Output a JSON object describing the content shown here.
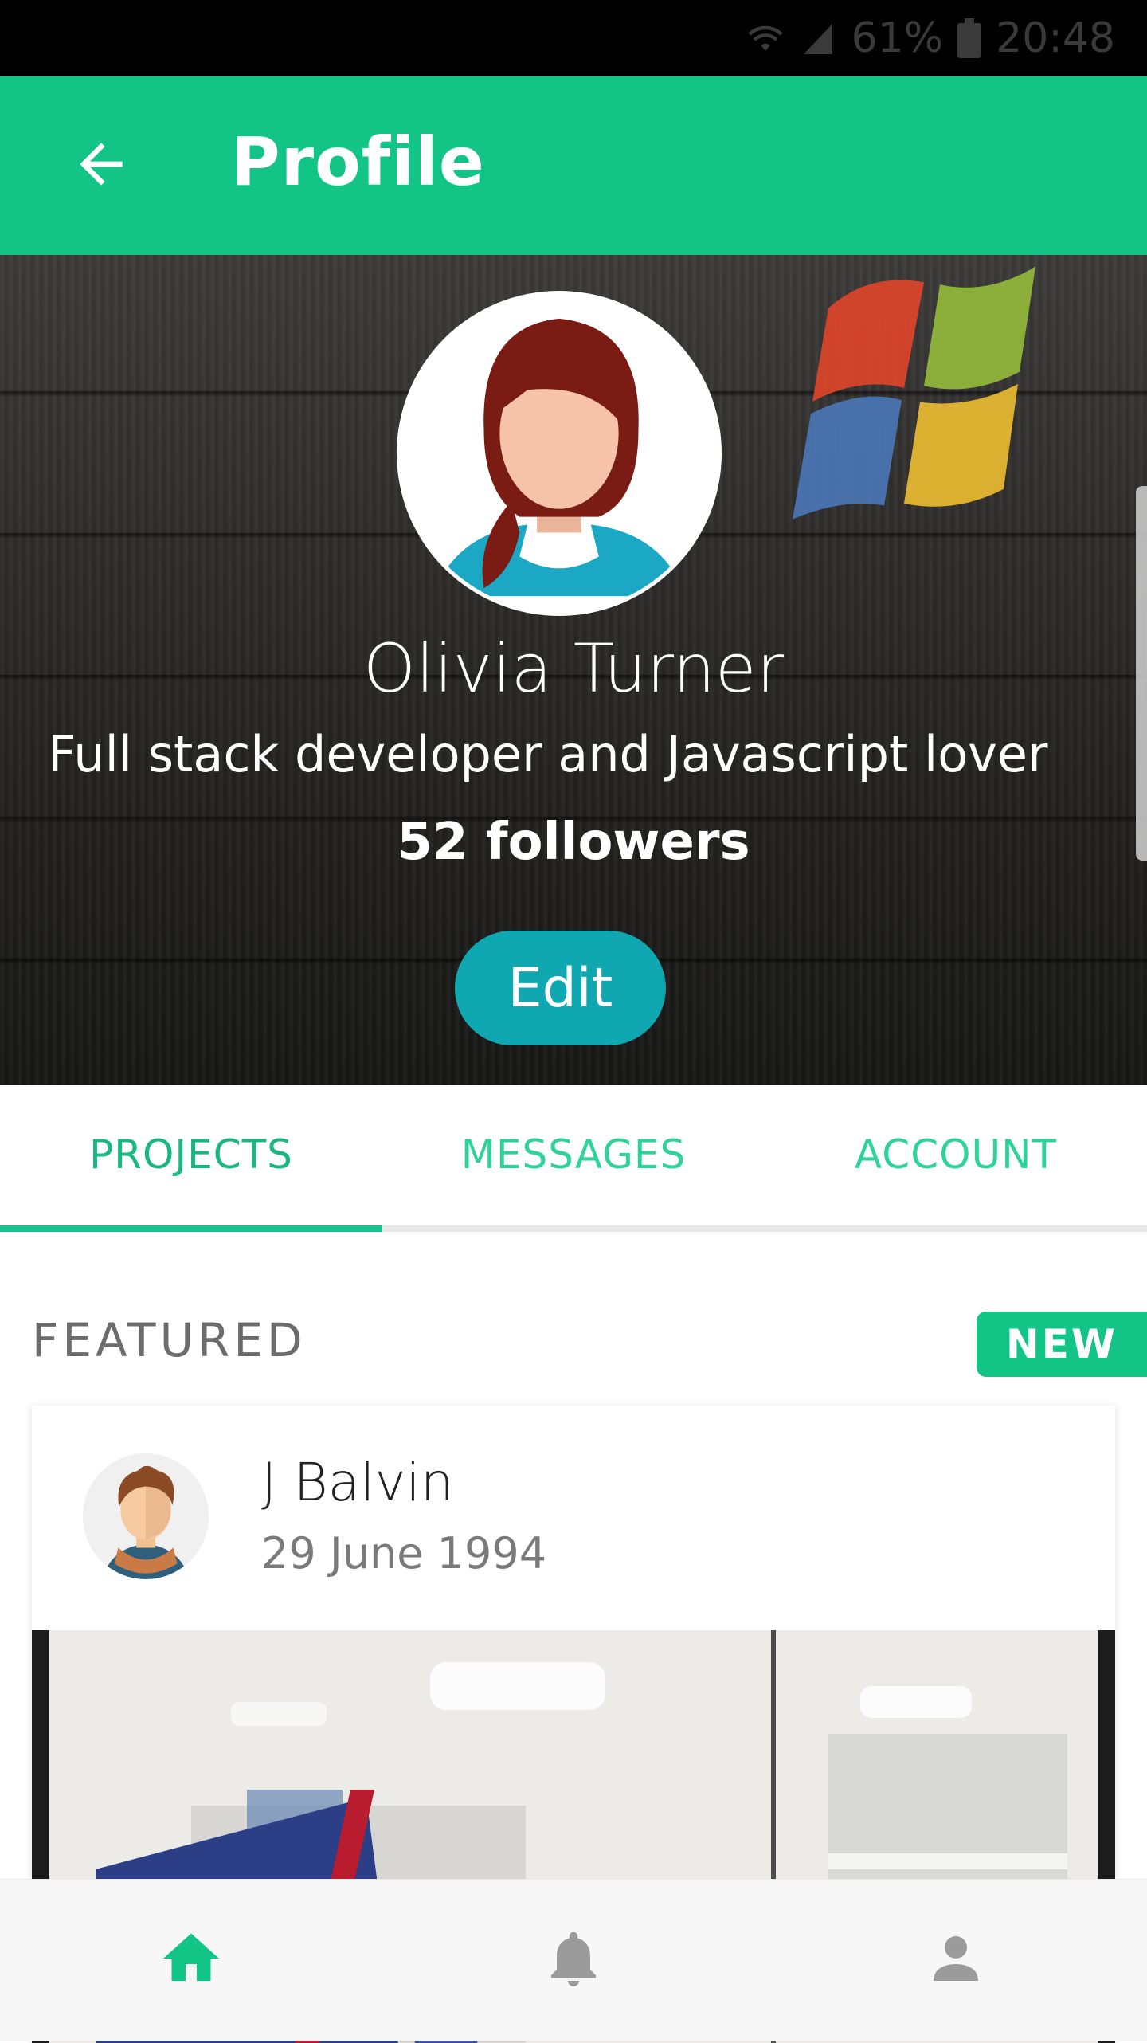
{
  "status_bar": {
    "battery": "61%",
    "time": "20:48",
    "icons": [
      "wifi-icon",
      "signal-icon",
      "battery-icon"
    ]
  },
  "app_bar": {
    "title": "Profile",
    "back_icon": "arrow-left-icon",
    "color": "#13c487"
  },
  "profile": {
    "name": "Olivia Turner",
    "bio": "Full stack developer and Javascript lover",
    "followers": "52 followers",
    "edit_label": "Edit",
    "edit_color": "#0fa7b0"
  },
  "tabs": {
    "items": [
      {
        "label": "PROJECTS",
        "active": true
      },
      {
        "label": "MESSAGES",
        "active": false
      },
      {
        "label": "ACCOUNT",
        "active": false
      }
    ],
    "accent": "#18c28b"
  },
  "featured": {
    "label": "FEATURED",
    "badge": "NEW"
  },
  "card": {
    "name": "J Balvin",
    "date": "29 June 1994"
  },
  "bottom_nav": {
    "items": [
      {
        "icon": "home-icon",
        "active": true
      },
      {
        "icon": "bell-icon",
        "active": false
      },
      {
        "icon": "person-icon",
        "active": false
      }
    ]
  }
}
